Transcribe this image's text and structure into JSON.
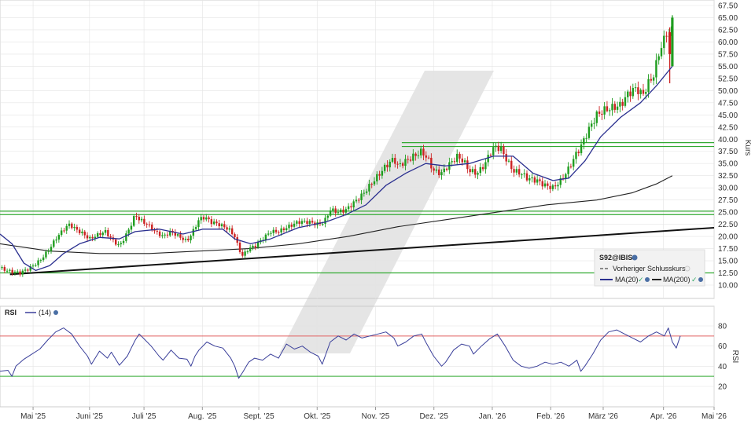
{
  "colors": {
    "background": "#ffffff",
    "grid": "#e4e4e4",
    "candle_up": "#1f9d1f",
    "candle_down": "#cc2222",
    "ma20": "#2a2f8f",
    "ma200": "#222222",
    "trendline": "#111111",
    "support_lines": "#33aa33",
    "rsi_line": "#3a3f9a",
    "rsi_upper": "#e06060",
    "rsi_lower": "#33aa33",
    "watermark": "#d9d9d9"
  },
  "icons": {
    "settings_icon": "gear-icon",
    "visibility_icon": "eye-icon"
  },
  "legend": {
    "symbol": "S92@IBIS",
    "prev_close": "Vorheriger Schlusskurs",
    "ma20": "MA(20)",
    "ma200": "MA(200)"
  },
  "rsi_legend": {
    "label": "RSI",
    "period": "(14)"
  },
  "chart_data": [
    {
      "type": "candlestick",
      "title": "",
      "ylabel": "Kurs",
      "ylim": [
        10,
        67.5
      ],
      "yticks": [
        "67.50",
        "65.00",
        "62.50",
        "60.00",
        "57.50",
        "55.00",
        "52.50",
        "50.00",
        "47.50",
        "45.00",
        "42.50",
        "40.00",
        "37.50",
        "35.00",
        "32.50",
        "30.00",
        "27.50",
        "25.00",
        "22.50",
        "20.00",
        "17.50",
        "15.00",
        "12.50",
        "10.00"
      ],
      "x_tick_labels": [
        "Mai '25",
        "Juni '25",
        "Juli '25",
        "Aug. '25",
        "Sept. '25",
        "Okt. '25",
        "Nov. '25",
        "Dez. '25",
        "Jan. '26",
        "Feb. '26",
        "März '26",
        "Apr. '26",
        "Mai '26"
      ],
      "close_path": [
        [
          0,
          13.5
        ],
        [
          5,
          12.8
        ],
        [
          10,
          12.5
        ],
        [
          15,
          13.5
        ],
        [
          20,
          15.0
        ],
        [
          25,
          17.5
        ],
        [
          28,
          19.5
        ],
        [
          32,
          21.5
        ],
        [
          35,
          22.5
        ],
        [
          38,
          21.5
        ],
        [
          42,
          20.5
        ],
        [
          45,
          19.5
        ],
        [
          50,
          20.5
        ],
        [
          53,
          21.0
        ],
        [
          56,
          19.5
        ],
        [
          60,
          18.0
        ],
        [
          63,
          20.0
        ],
        [
          66,
          22.5
        ],
        [
          68,
          24.5
        ],
        [
          70,
          23.5
        ],
        [
          74,
          22.5
        ],
        [
          78,
          21.0
        ],
        [
          82,
          20.0
        ],
        [
          86,
          21.0
        ],
        [
          90,
          20.0
        ],
        [
          94,
          19.0
        ],
        [
          97,
          21.0
        ],
        [
          100,
          23.5
        ],
        [
          103,
          24.0
        ],
        [
          106,
          23.0
        ],
        [
          110,
          22.5
        ],
        [
          115,
          21.5
        ],
        [
          118,
          20.0
        ],
        [
          120,
          17.5
        ],
        [
          122,
          16.0
        ],
        [
          125,
          17.5
        ],
        [
          128,
          18.0
        ],
        [
          132,
          19.5
        ],
        [
          136,
          21.0
        ],
        [
          140,
          21.0
        ],
        [
          145,
          22.0
        ],
        [
          150,
          23.0
        ],
        [
          155,
          23.0
        ],
        [
          160,
          22.5
        ],
        [
          163,
          23.0
        ],
        [
          166,
          25.5
        ],
        [
          170,
          25.0
        ],
        [
          174,
          25.5
        ],
        [
          178,
          27.0
        ],
        [
          182,
          28.5
        ],
        [
          186,
          30.5
        ],
        [
          190,
          32.5
        ],
        [
          194,
          34.5
        ],
        [
          198,
          36.0
        ],
        [
          200,
          34.5
        ],
        [
          204,
          35.5
        ],
        [
          208,
          36.5
        ],
        [
          212,
          37.5
        ],
        [
          215,
          36.0
        ],
        [
          218,
          33.5
        ],
        [
          222,
          33.0
        ],
        [
          225,
          34.5
        ],
        [
          230,
          36.5
        ],
        [
          233,
          35.5
        ],
        [
          236,
          33.5
        ],
        [
          240,
          33.0
        ],
        [
          244,
          35.0
        ],
        [
          246,
          37.0
        ],
        [
          249,
          38.5
        ],
        [
          252,
          38.0
        ],
        [
          255,
          35.5
        ],
        [
          258,
          33.5
        ],
        [
          262,
          33.0
        ],
        [
          265,
          32.0
        ],
        [
          270,
          31.5
        ],
        [
          274,
          30.5
        ],
        [
          278,
          30.0
        ],
        [
          282,
          31.5
        ],
        [
          286,
          34.0
        ],
        [
          289,
          36.5
        ],
        [
          292,
          38.5
        ],
        [
          296,
          42.0
        ],
        [
          300,
          45.0
        ],
        [
          304,
          46.0
        ],
        [
          308,
          46.5
        ],
        [
          312,
          47.0
        ],
        [
          316,
          49.5
        ],
        [
          320,
          50.5
        ],
        [
          323,
          49.0
        ],
        [
          326,
          51.5
        ],
        [
          329,
          53.5
        ],
        [
          331,
          57.5
        ],
        [
          334,
          60.5
        ],
        [
          336,
          63.5
        ],
        [
          337,
          57.5
        ],
        [
          338,
          64.5
        ]
      ],
      "ma20_path": [
        [
          0,
          20.5
        ],
        [
          6,
          18.5
        ],
        [
          12,
          14.5
        ],
        [
          18,
          13.0
        ],
        [
          25,
          14.0
        ],
        [
          32,
          16.5
        ],
        [
          40,
          18.5
        ],
        [
          50,
          19.8
        ],
        [
          60,
          19.5
        ],
        [
          68,
          21.0
        ],
        [
          80,
          21.5
        ],
        [
          92,
          20.5
        ],
        [
          102,
          21.5
        ],
        [
          112,
          21.5
        ],
        [
          118,
          19.5
        ],
        [
          126,
          18.5
        ],
        [
          136,
          19.5
        ],
        [
          150,
          21.8
        ],
        [
          164,
          23.0
        ],
        [
          174,
          24.5
        ],
        [
          184,
          26.5
        ],
        [
          194,
          30.5
        ],
        [
          204,
          33.0
        ],
        [
          214,
          35.0
        ],
        [
          224,
          34.5
        ],
        [
          236,
          35.0
        ],
        [
          248,
          36.5
        ],
        [
          258,
          36.5
        ],
        [
          268,
          33.0
        ],
        [
          278,
          31.5
        ],
        [
          286,
          32.0
        ],
        [
          294,
          35.5
        ],
        [
          302,
          40.5
        ],
        [
          312,
          44.5
        ],
        [
          322,
          47.5
        ],
        [
          330,
          51.0
        ],
        [
          338,
          55.0
        ]
      ],
      "ma200_path": [
        [
          0,
          18.5
        ],
        [
          25,
          17.0
        ],
        [
          50,
          16.5
        ],
        [
          75,
          16.5
        ],
        [
          100,
          17.0
        ],
        [
          125,
          17.5
        ],
        [
          150,
          18.5
        ],
        [
          175,
          20.0
        ],
        [
          200,
          22.0
        ],
        [
          225,
          23.5
        ],
        [
          250,
          25.0
        ],
        [
          275,
          26.5
        ],
        [
          300,
          27.5
        ],
        [
          318,
          29.0
        ],
        [
          330,
          30.8
        ],
        [
          338,
          32.5
        ]
      ],
      "trendline": [
        [
          5,
          12.2
        ],
        [
          359,
          21.8
        ]
      ],
      "support_levels": [
        12.5,
        24.5,
        25.2,
        38.5,
        39.3
      ]
    },
    {
      "type": "line",
      "title": "",
      "ylabel": "RSI",
      "ylim": [
        10,
        90
      ],
      "yticks": [
        "80",
        "60",
        "40",
        "20"
      ],
      "reference_lines": [
        70,
        30
      ],
      "rsi_path": [
        [
          0,
          35
        ],
        [
          4,
          36
        ],
        [
          6,
          30
        ],
        [
          8,
          40
        ],
        [
          12,
          47
        ],
        [
          16,
          52
        ],
        [
          20,
          57
        ],
        [
          24,
          66
        ],
        [
          28,
          74
        ],
        [
          32,
          78
        ],
        [
          36,
          72
        ],
        [
          40,
          60
        ],
        [
          44,
          50
        ],
        [
          46,
          42
        ],
        [
          50,
          55
        ],
        [
          54,
          48
        ],
        [
          56,
          54
        ],
        [
          60,
          41
        ],
        [
          64,
          50
        ],
        [
          66,
          58
        ],
        [
          68,
          66
        ],
        [
          70,
          72
        ],
        [
          72,
          68
        ],
        [
          76,
          60
        ],
        [
          80,
          50
        ],
        [
          82,
          46
        ],
        [
          86,
          56
        ],
        [
          90,
          48
        ],
        [
          94,
          47
        ],
        [
          96,
          40
        ],
        [
          98,
          50
        ],
        [
          100,
          56
        ],
        [
          104,
          64
        ],
        [
          108,
          60
        ],
        [
          112,
          58
        ],
        [
          116,
          48
        ],
        [
          118,
          40
        ],
        [
          120,
          28
        ],
        [
          122,
          34
        ],
        [
          125,
          44
        ],
        [
          128,
          48
        ],
        [
          132,
          46
        ],
        [
          136,
          52
        ],
        [
          140,
          48
        ],
        [
          144,
          62
        ],
        [
          148,
          57
        ],
        [
          152,
          60
        ],
        [
          156,
          54
        ],
        [
          160,
          50
        ],
        [
          162,
          42
        ],
        [
          166,
          64
        ],
        [
          170,
          70
        ],
        [
          174,
          66
        ],
        [
          178,
          72
        ],
        [
          182,
          68
        ],
        [
          186,
          70
        ],
        [
          190,
          72
        ],
        [
          194,
          74
        ],
        [
          198,
          68
        ],
        [
          200,
          60
        ],
        [
          204,
          64
        ],
        [
          208,
          70
        ],
        [
          212,
          72
        ],
        [
          214,
          64
        ],
        [
          218,
          50
        ],
        [
          222,
          40
        ],
        [
          224,
          44
        ],
        [
          228,
          56
        ],
        [
          232,
          62
        ],
        [
          236,
          60
        ],
        [
          238,
          52
        ],
        [
          242,
          60
        ],
        [
          246,
          67
        ],
        [
          250,
          72
        ],
        [
          254,
          60
        ],
        [
          258,
          46
        ],
        [
          262,
          40
        ],
        [
          266,
          38
        ],
        [
          270,
          40
        ],
        [
          274,
          44
        ],
        [
          278,
          42
        ],
        [
          282,
          44
        ],
        [
          286,
          40
        ],
        [
          290,
          46
        ],
        [
          292,
          35
        ],
        [
          294,
          40
        ],
        [
          298,
          52
        ],
        [
          302,
          66
        ],
        [
          306,
          74
        ],
        [
          310,
          76
        ],
        [
          314,
          72
        ],
        [
          318,
          68
        ],
        [
          322,
          64
        ],
        [
          326,
          70
        ],
        [
          330,
          74
        ],
        [
          334,
          70
        ],
        [
          336,
          78
        ],
        [
          338,
          64
        ],
        [
          340,
          58
        ],
        [
          342,
          70
        ]
      ]
    }
  ]
}
